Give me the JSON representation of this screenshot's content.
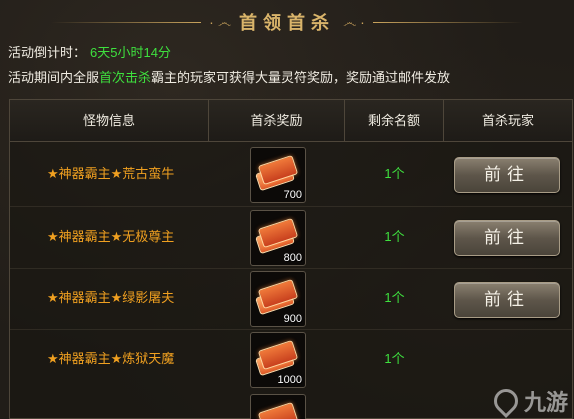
{
  "header": {
    "title": "首领首杀",
    "ornament_left": "· ෴",
    "ornament_right": "෴ ·"
  },
  "countdown": {
    "label": "活动倒计时：",
    "value": "6天5小时14分"
  },
  "description": {
    "prefix": "活动期间内全服",
    "highlight": "首次击杀",
    "suffix": "霸主的玩家可获得大量灵符奖励，奖励通过邮件发放"
  },
  "table": {
    "headers": [
      "怪物信息",
      "首杀奖励",
      "剩余名额",
      "首杀玩家"
    ],
    "rows": [
      {
        "monster": "★神器霸主★荒古蛮牛",
        "reward_qty": "700",
        "remaining": "1个",
        "action": "前往"
      },
      {
        "monster": "★神器霸主★无极尊主",
        "reward_qty": "800",
        "remaining": "1个",
        "action": "前往"
      },
      {
        "monster": "★神器霸主★绿影屠夫",
        "reward_qty": "900",
        "remaining": "1个",
        "action": "前往"
      },
      {
        "monster": "★神器霸主★炼狱天魔",
        "reward_qty": "1000",
        "remaining": "1个",
        "action": ""
      }
    ]
  },
  "watermark": {
    "text": "九游"
  },
  "colors": {
    "accent_gold": "#d9b46a",
    "monster_name": "#f0a020",
    "highlight_green": "#3ee03e"
  },
  "icons": {
    "reward": "talisman-scroll-icon",
    "watermark": "jiuyou-logo-icon"
  }
}
